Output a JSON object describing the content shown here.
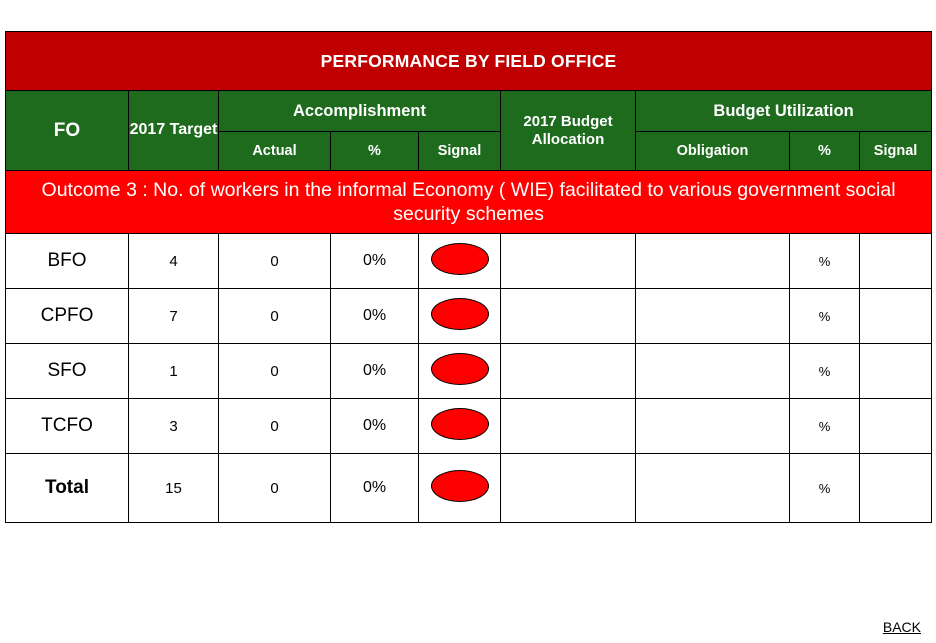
{
  "title": "PERFORMANCE BY FIELD OFFICE",
  "header": {
    "fo": "FO",
    "target": "2017 Target",
    "accomplishment": "Accomplishment",
    "actual": "Actual",
    "percent": "%",
    "signal": "Signal",
    "budget_allocation": "2017 Budget Allocation",
    "budget_utilization": "Budget Utilization",
    "obligation": "Obligation",
    "util_percent": "%",
    "util_signal": "Signal"
  },
  "outcome": "Outcome 3 : No. of workers in the informal Economy ( WIE) facilitated to various government social security schemes",
  "rows": [
    {
      "fo": "BFO",
      "target": "4",
      "actual": "0",
      "percent": "0%",
      "signal": "red",
      "allocation": "",
      "obligation": "",
      "util_percent": "%",
      "util_signal": ""
    },
    {
      "fo": "CPFO",
      "target": "7",
      "actual": "0",
      "percent": "0%",
      "signal": "red",
      "allocation": "",
      "obligation": "",
      "util_percent": "%",
      "util_signal": ""
    },
    {
      "fo": "SFO",
      "target": "1",
      "actual": "0",
      "percent": "0%",
      "signal": "red",
      "allocation": "",
      "obligation": "",
      "util_percent": "%",
      "util_signal": ""
    },
    {
      "fo": "TCFO",
      "target": "3",
      "actual": "0",
      "percent": "0%",
      "signal": "red",
      "allocation": "",
      "obligation": "",
      "util_percent": "%",
      "util_signal": ""
    },
    {
      "fo": "Total",
      "target": "15",
      "actual": "0",
      "percent": "0%",
      "signal": "red",
      "allocation": "",
      "obligation": "",
      "util_percent": "%",
      "util_signal": ""
    }
  ],
  "back_label": "BACK",
  "colors": {
    "title_bg": "#c00000",
    "header_bg": "#1e6b1e",
    "outcome_bg": "#ff0000",
    "signal_red": "#ff0000"
  }
}
